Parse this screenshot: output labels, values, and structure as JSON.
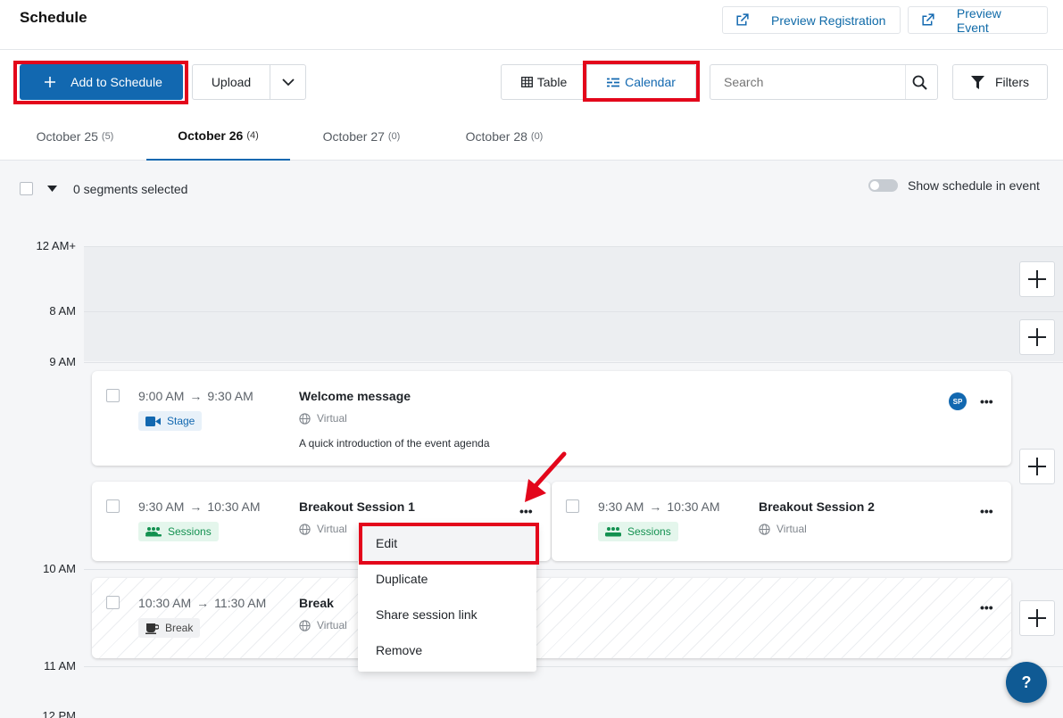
{
  "header": {
    "title": "Schedule",
    "preview_registration": "Preview Registration",
    "preview_event": "Preview Event"
  },
  "toolbar": {
    "add_to_schedule": "Add to Schedule",
    "upload": "Upload",
    "view_table": "Table",
    "view_calendar": "Calendar",
    "search_placeholder": "Search",
    "filters": "Filters"
  },
  "tabs": [
    {
      "label": "October 25",
      "count": "(5)",
      "active": false
    },
    {
      "label": "October 26",
      "count": "(4)",
      "active": true
    },
    {
      "label": "October 27",
      "count": "(0)",
      "active": false
    },
    {
      "label": "October 28",
      "count": "(0)",
      "active": false
    }
  ],
  "selection": {
    "label": "0 segments selected",
    "show_schedule_label": "Show schedule in event",
    "show_schedule_on": false
  },
  "time_labels": [
    "12 AM+",
    "8 AM",
    "9 AM",
    "10 AM",
    "11 AM",
    "12 PM"
  ],
  "segments": [
    {
      "start": "9:00 AM",
      "end": "9:30 AM",
      "title": "Welcome message",
      "location": "Virtual",
      "tag": "Stage",
      "description": "A quick introduction of the event agenda",
      "speaker_initials": "SP"
    },
    {
      "start": "9:30 AM",
      "end": "10:30 AM",
      "title": "Breakout Session 1",
      "location": "Virtual",
      "tag": "Sessions"
    },
    {
      "start": "9:30 AM",
      "end": "10:30 AM",
      "title": "Breakout Session 2",
      "location": "Virtual",
      "tag": "Sessions"
    },
    {
      "start": "10:30 AM",
      "end": "11:30 AM",
      "title": "Break",
      "location": "Virtual",
      "tag": "Break"
    }
  ],
  "arrow_glyph": "→",
  "context_menu": {
    "items": [
      "Edit",
      "Duplicate",
      "Share session link",
      "Remove"
    ]
  },
  "help_button": "?",
  "colors": {
    "primary": "#1268b0",
    "highlight": "#e3061b",
    "sessions_green": "#139150"
  },
  "icons": [
    "external-link-icon",
    "plus-icon",
    "chevron-down-icon",
    "table-icon",
    "calendar-icon",
    "search-icon",
    "filter-icon",
    "caret-down-icon",
    "video-icon",
    "globe-icon",
    "group-icon",
    "coffee-icon",
    "more-icon"
  ]
}
